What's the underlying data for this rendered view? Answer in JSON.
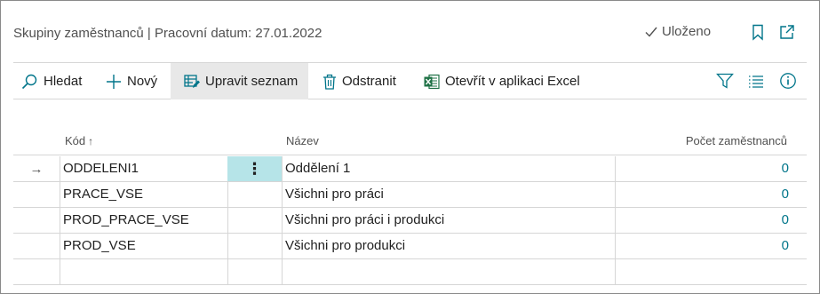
{
  "page": {
    "title": "Skupiny zaměstnanců | Pracovní datum: 27.01.2022",
    "saved_label": "Uloženo"
  },
  "header_icons": [
    "bookmark-icon",
    "open-new-window-icon"
  ],
  "actions": {
    "search": "Hledat",
    "new": "Nový",
    "edit_list": "Upravit seznam",
    "delete": "Odstranit",
    "open_excel": "Otevřít v aplikaci Excel"
  },
  "bar_icons": [
    "filter-icon",
    "list-view-icon",
    "info-icon"
  ],
  "table": {
    "columns": {
      "code": "Kód",
      "sort_arrow": "↑",
      "name": "Název",
      "count": "Počet zaměstnanců"
    },
    "rows": [
      {
        "code": "ODDELENI1",
        "name": "Oddělení 1",
        "count": "0",
        "selected": true
      },
      {
        "code": "PRACE_VSE",
        "name": "Všichni pro práci",
        "count": "0"
      },
      {
        "code": "PROD_PRACE_VSE",
        "name": "Všichni pro práci i produkci",
        "count": "0"
      },
      {
        "code": "PROD_VSE",
        "name": "Všichni pro produkci",
        "count": "0"
      }
    ],
    "row_indicator": "→",
    "row_menu": "⋮"
  },
  "colors": {
    "accent": "#00758a",
    "selected_cell": "#b6e4e8",
    "excel_green": "#1e7145",
    "active_action_bg": "#e8e8e8"
  }
}
